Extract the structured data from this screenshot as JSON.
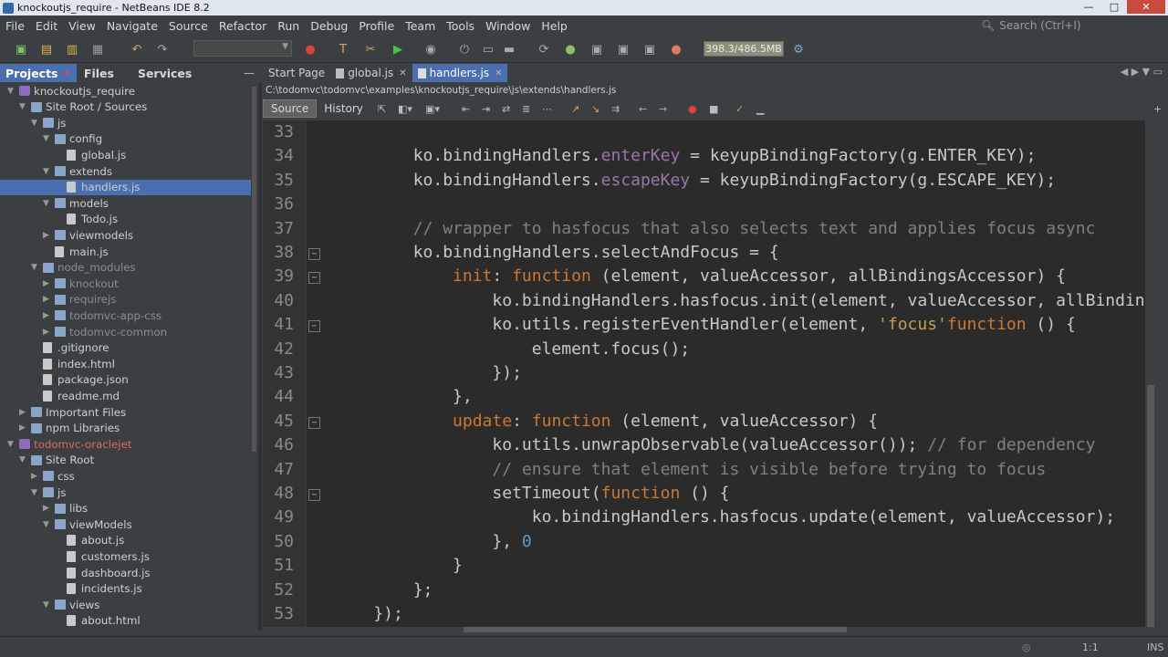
{
  "window": {
    "title": "knockoutjs_require - NetBeans IDE 8.2",
    "controls": [
      "—",
      "□",
      "✕"
    ]
  },
  "menu": [
    "File",
    "Edit",
    "View",
    "Navigate",
    "Source",
    "Refactor",
    "Run",
    "Debug",
    "Profile",
    "Team",
    "Tools",
    "Window",
    "Help"
  ],
  "search": {
    "placeholder": "Search (Ctrl+I)"
  },
  "toolbar": {
    "memory": "398.3/486.5MB"
  },
  "panel_tabs": [
    {
      "label": "Projects",
      "closable": true
    },
    {
      "label": "Files"
    },
    {
      "label": "Services"
    }
  ],
  "tree": [
    {
      "label": "knockoutjs_require",
      "depth": 0,
      "type": "project",
      "open": true
    },
    {
      "label": "Site Root / Sources",
      "depth": 1,
      "type": "folder",
      "open": true
    },
    {
      "label": "js",
      "depth": 2,
      "type": "folder",
      "open": true
    },
    {
      "label": "config",
      "depth": 3,
      "type": "folder",
      "open": true
    },
    {
      "label": "global.js",
      "depth": 4,
      "type": "file"
    },
    {
      "label": "extends",
      "depth": 3,
      "type": "folder",
      "open": true
    },
    {
      "label": "handlers.js",
      "depth": 4,
      "type": "file",
      "selected": true
    },
    {
      "label": "models",
      "depth": 3,
      "type": "folder",
      "open": true
    },
    {
      "label": "Todo.js",
      "depth": 4,
      "type": "file"
    },
    {
      "label": "viewmodels",
      "depth": 3,
      "type": "folder",
      "open": false
    },
    {
      "label": "main.js",
      "depth": 3,
      "type": "file"
    },
    {
      "label": "node_modules",
      "depth": 2,
      "type": "folder",
      "open": true,
      "dim": true
    },
    {
      "label": "knockout",
      "depth": 3,
      "type": "folder",
      "open": false,
      "dim": true
    },
    {
      "label": "requirejs",
      "depth": 3,
      "type": "folder",
      "open": false,
      "dim": true
    },
    {
      "label": "todomvc-app-css",
      "depth": 3,
      "type": "folder",
      "open": false,
      "dim": true
    },
    {
      "label": "todomvc-common",
      "depth": 3,
      "type": "folder",
      "open": false,
      "dim": true
    },
    {
      "label": ".gitignore",
      "depth": 2,
      "type": "file"
    },
    {
      "label": "index.html",
      "depth": 2,
      "type": "file"
    },
    {
      "label": "package.json",
      "depth": 2,
      "type": "file"
    },
    {
      "label": "readme.md",
      "depth": 2,
      "type": "file"
    },
    {
      "label": "Important Files",
      "depth": 1,
      "type": "folder",
      "open": false
    },
    {
      "label": "npm Libraries",
      "depth": 1,
      "type": "folder",
      "open": false
    },
    {
      "label": "todomvc-oraclejet",
      "depth": 0,
      "type": "project",
      "open": true,
      "red": true
    },
    {
      "label": "Site Root",
      "depth": 1,
      "type": "folder",
      "open": true
    },
    {
      "label": "css",
      "depth": 2,
      "type": "folder",
      "open": false
    },
    {
      "label": "js",
      "depth": 2,
      "type": "folder",
      "open": true
    },
    {
      "label": "libs",
      "depth": 3,
      "type": "folder",
      "open": false
    },
    {
      "label": "viewModels",
      "depth": 3,
      "type": "folder",
      "open": true
    },
    {
      "label": "about.js",
      "depth": 4,
      "type": "file"
    },
    {
      "label": "customers.js",
      "depth": 4,
      "type": "file"
    },
    {
      "label": "dashboard.js",
      "depth": 4,
      "type": "file"
    },
    {
      "label": "incidents.js",
      "depth": 4,
      "type": "file"
    },
    {
      "label": "views",
      "depth": 3,
      "type": "folder",
      "open": true
    },
    {
      "label": "about.html",
      "depth": 4,
      "type": "file"
    }
  ],
  "editor_tabs": [
    {
      "label": "Start Page"
    },
    {
      "label": "global.js",
      "closable": true
    },
    {
      "label": "handlers.js",
      "closable": true,
      "active": true
    }
  ],
  "file_path": "C:\\todomvc\\todomvc\\examples\\knockoutjs_require\\js\\extends\\handlers.js",
  "source_tabs": [
    {
      "label": "Source",
      "active": true
    },
    {
      "label": "History"
    }
  ],
  "code": [
    {
      "n": "33",
      "fold": false,
      "segs": []
    },
    {
      "n": "34",
      "fold": false,
      "segs": [
        [
          "",
          "        ko.bindingHandlers."
        ],
        [
          "p",
          "enterKey"
        ],
        [
          "",
          " = keyupBindingFactory(g.ENTER_KEY);"
        ]
      ]
    },
    {
      "n": "35",
      "fold": false,
      "segs": [
        [
          "",
          "        ko.bindingHandlers."
        ],
        [
          "p",
          "escapeKey"
        ],
        [
          "",
          " = keyupBindingFactory(g.ESCAPE_KEY);"
        ]
      ]
    },
    {
      "n": "36",
      "fold": false,
      "segs": []
    },
    {
      "n": "37",
      "fold": false,
      "segs": [
        [
          "c",
          "        // wrapper to hasfocus that also selects text and applies focus async"
        ]
      ]
    },
    {
      "n": "38",
      "fold": true,
      "segs": [
        [
          "",
          "        ko.bindingHandlers.selectAndFocus = {"
        ]
      ]
    },
    {
      "n": "39",
      "fold": true,
      "segs": [
        [
          "",
          "            "
        ],
        [
          "k",
          "init"
        ],
        [
          "",
          ": "
        ],
        [
          "k",
          "function"
        ],
        [
          "",
          " (element, valueAccessor, allBindingsAccessor) {"
        ]
      ]
    },
    {
      "n": "40",
      "fold": false,
      "segs": [
        [
          "",
          "                ko.bindingHandlers.hasfocus.init(element, valueAccessor, allBindingsAccessor);"
        ]
      ]
    },
    {
      "n": "41",
      "fold": true,
      "segs": [
        [
          "",
          "                ko.utils.registerEventHandler(element, "
        ],
        [
          "s",
          "'focus'"
        ],
        [
          ", "
        ],
        [
          "k",
          "function"
        ],
        [
          "",
          " () {"
        ]
      ]
    },
    {
      "n": "42",
      "fold": false,
      "segs": [
        [
          "",
          "                    element.focus();"
        ]
      ]
    },
    {
      "n": "43",
      "fold": false,
      "segs": [
        [
          "",
          "                });"
        ]
      ]
    },
    {
      "n": "44",
      "fold": false,
      "segs": [
        [
          "",
          "            },"
        ]
      ]
    },
    {
      "n": "45",
      "fold": true,
      "segs": [
        [
          "",
          "            "
        ],
        [
          "k",
          "update"
        ],
        [
          "",
          ": "
        ],
        [
          "k",
          "function"
        ],
        [
          "",
          " (element, valueAccessor) {"
        ]
      ]
    },
    {
      "n": "46",
      "fold": false,
      "segs": [
        [
          "",
          "                ko.utils.unwrapObservable(valueAccessor()); "
        ],
        [
          "c",
          "// for dependency"
        ]
      ]
    },
    {
      "n": "47",
      "fold": false,
      "segs": [
        [
          "c",
          "                // ensure that element is visible before trying to focus"
        ]
      ]
    },
    {
      "n": "48",
      "fold": true,
      "segs": [
        [
          "",
          "                setTimeout("
        ],
        [
          "k",
          "function"
        ],
        [
          "",
          " () {"
        ]
      ]
    },
    {
      "n": "49",
      "fold": false,
      "segs": [
        [
          "",
          "                    ko.bindingHandlers.hasfocus.update(element, valueAccessor);"
        ]
      ]
    },
    {
      "n": "50",
      "fold": false,
      "segs": [
        [
          "",
          "                }, "
        ],
        [
          "n",
          "0"
        ],
        [
          ");"
        ]
      ]
    },
    {
      "n": "51",
      "fold": false,
      "segs": [
        [
          "",
          "            }"
        ]
      ]
    },
    {
      "n": "52",
      "fold": false,
      "segs": [
        [
          "",
          "        };"
        ]
      ]
    },
    {
      "n": "53",
      "fold": false,
      "segs": [
        [
          "",
          "    });"
        ]
      ]
    }
  ],
  "status": {
    "position": "1:1",
    "mode": "INS"
  },
  "colors": {
    "accent": "#4b6eaf",
    "editor_bg": "#2b2b2b",
    "keyword": "#cc7832",
    "property": "#9876aa",
    "string": "#c89b4e",
    "comment": "#808080",
    "number": "#6897bb"
  }
}
